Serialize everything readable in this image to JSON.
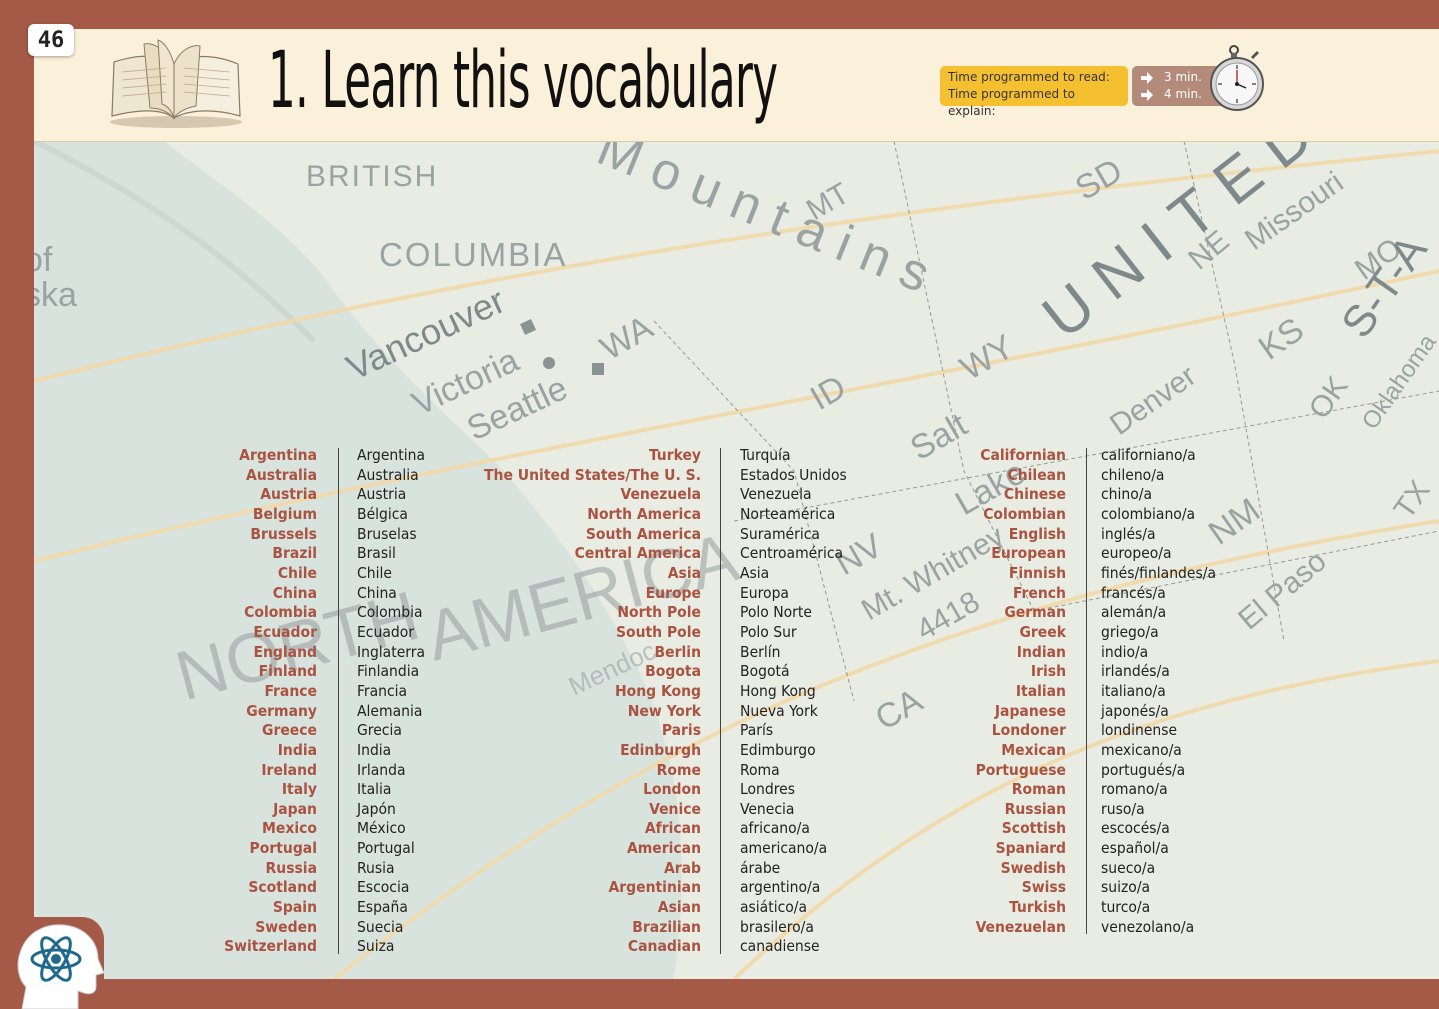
{
  "page_number": "46",
  "title": "1. Learn this vocabulary",
  "time": {
    "read_label": "Time programmed to read:",
    "explain_label": "Time programmed to explain:",
    "read_value": "3 min.",
    "explain_value": "4 min."
  },
  "map_labels": [
    "BRITISH",
    "COLUMBIA",
    "Mountains",
    "MT",
    "SD",
    "UNITED",
    "Missouri",
    "MO",
    "NE",
    "S-T-A",
    "Vancouver",
    "Victoria",
    "Seattle",
    "WA",
    "ID",
    "WY",
    "KS",
    "OK",
    "Oklahoma",
    "Denver",
    "Salt",
    "Lake",
    "NV",
    "NM",
    "TX",
    "El Paso",
    "Mt. Whitney",
    "4418",
    "CA",
    "of",
    "ska",
    "NORTH",
    "AMERICA",
    "Mendoc"
  ],
  "columns": [
    {
      "english": [
        "Argentina",
        "Australia",
        "Austria",
        "Belgium",
        "Brussels",
        "Brazil",
        "Chile",
        "China",
        "Colombia",
        "Ecuador",
        "England",
        "Finland",
        "France",
        "Germany",
        "Greece",
        "India",
        "Ireland",
        "Italy",
        "Japan",
        "Mexico",
        "Portugal",
        "Russia",
        "Scotland",
        "Spain",
        "Sweden",
        "Switzerland"
      ],
      "spanish": [
        "Argentina",
        "Australia",
        "Austria",
        "Bélgica",
        "Bruselas",
        "Brasil",
        "Chile",
        "China",
        "Colombia",
        "Ecuador",
        "Inglaterra",
        "Finlandia",
        "Francia",
        "Alemania",
        "Grecia",
        "India",
        "Irlanda",
        "Italia",
        "Japón",
        "México",
        "Portugal",
        "Rusia",
        "Escocia",
        "España",
        "Suecia",
        "Suiza"
      ]
    },
    {
      "english": [
        "Turkey",
        "The United States/The U. S.",
        "Venezuela",
        "North America",
        "South America",
        "Central America",
        "Asia",
        "Europe",
        "North Pole",
        "South Pole",
        "Berlin",
        "Bogota",
        "Hong Kong",
        "New York",
        "Paris",
        "Edinburgh",
        "Rome",
        "London",
        "Venice",
        "African",
        "American",
        "Arab",
        "Argentinian",
        "Asian",
        "Brazilian",
        "Canadian"
      ],
      "spanish": [
        "Turquía",
        "Estados Unidos",
        "Venezuela",
        "Norteamérica",
        "Suramérica",
        "Centroamérica",
        "Asia",
        "Europa",
        "Polo Norte",
        "Polo Sur",
        "Berlín",
        "Bogotá",
        "Hong Kong",
        "Nueva York",
        "París",
        "Edimburgo",
        "Roma",
        "Londres",
        "Venecia",
        "africano/a",
        "americano/a",
        "árabe",
        "argentino/a",
        "asiático/a",
        "brasilero/a",
        "canadiense"
      ]
    },
    {
      "english": [
        "Californian",
        "Chilean",
        "Chinese",
        "Colombian",
        "English",
        "European",
        "Finnish",
        "French",
        "German",
        "Greek",
        "Indian",
        "Irish",
        "Italian",
        "Japanese",
        "Londoner",
        "Mexican",
        "Portuguese",
        "Roman",
        "Russian",
        "Scottish",
        "Spaniard",
        "Swedish",
        "Swiss",
        "Turkish",
        "Venezuelan"
      ],
      "spanish": [
        "californiano/a",
        "chileno/a",
        "chino/a",
        "colombiano/a",
        "inglés/a",
        "europeo/a",
        "finés/finlandes/a",
        "francés/a",
        "alemán/a",
        "griego/a",
        "indio/a",
        "irlandés/a",
        "italiano/a",
        "japonés/a",
        "londinense",
        "mexicano/a",
        "portugués/a",
        "romano/a",
        "ruso/a",
        "escocés/a",
        "español/a",
        "sueco/a",
        "suizo/a",
        "turco/a",
        "venezolano/a"
      ]
    }
  ],
  "colors": {
    "border": "#a45a46",
    "header_bg": "#fbf1db",
    "english_word": "#a95340",
    "time_label_bg": "#f5c030",
    "time_value_bg": "#b48a7b"
  },
  "icons": [
    "open-book-icon",
    "stopwatch-icon",
    "arrow-right-icon",
    "brain-atom-icon"
  ]
}
